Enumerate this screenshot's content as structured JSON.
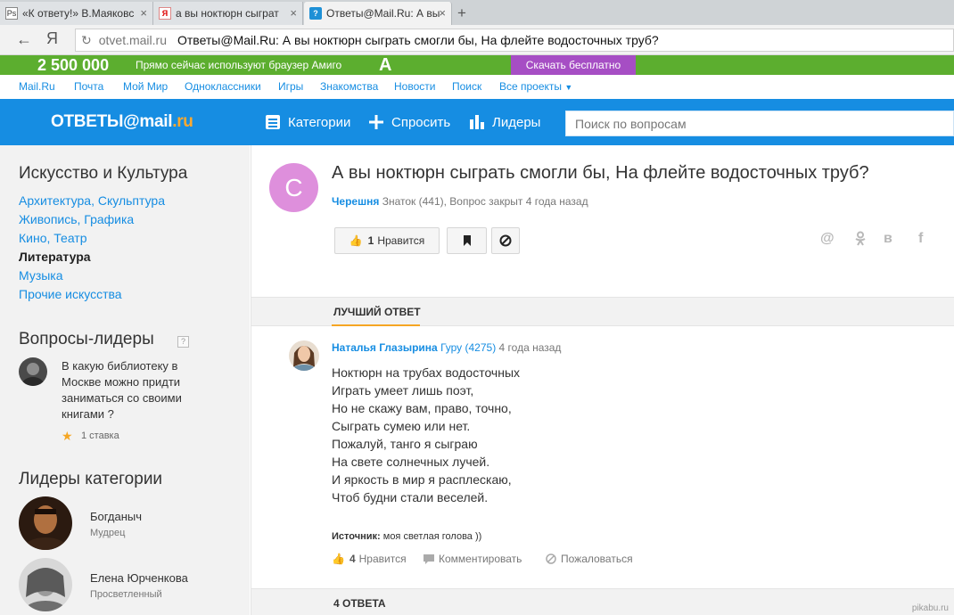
{
  "browser": {
    "tabs": [
      {
        "title": "«К ответу!» В.Маяковс",
        "favicon": "Ps",
        "active": false
      },
      {
        "title": "а вы ноктюрн сыграт",
        "favicon": "Я",
        "active": false
      },
      {
        "title": "Ответы@Mail.Ru: А вы",
        "favicon": "?",
        "active": true
      }
    ],
    "new_tab": "+",
    "back": "←",
    "home": "Я",
    "refresh": "↻",
    "url_host": "otvet.mail.ru",
    "url_title": "Ответы@Mail.Ru: А вы ноктюрн сыграть смогли бы, На флейте водосточных труб?"
  },
  "amigo": {
    "count": "2 500 000",
    "text": "Прямо сейчас используют браузер Амиго",
    "logo": "A",
    "download": "Скачать бесплатно",
    "bg_color": "#5cae2f",
    "button_color": "#a64ec4"
  },
  "portal_nav": [
    "Mail.Ru",
    "Почта",
    "Мой Мир",
    "Одноклассники",
    "Игры",
    "Знакомства",
    "Новости",
    "Поиск",
    "Все проекты"
  ],
  "header": {
    "brand_main": "ОТВЕТЫ@mail",
    "brand_ru": ".ru",
    "categories": "Категории",
    "ask": "Спросить",
    "leaders": "Лидеры",
    "search_placeholder": "Поиск по вопросам",
    "color": "#168de2"
  },
  "sidebar": {
    "category_title": "Искусство и Культура",
    "subcategories": [
      {
        "label": "Архитектура, Скульптура",
        "current": false
      },
      {
        "label": "Живопись, Графика",
        "current": false
      },
      {
        "label": "Кино, Театр",
        "current": false
      },
      {
        "label": "Литература",
        "current": true
      },
      {
        "label": "Музыка",
        "current": false
      },
      {
        "label": "Прочие искусства",
        "current": false
      }
    ],
    "leader_questions_title": "Вопросы-лидеры",
    "help_icon": "?",
    "leader_question": "В какую библиотеку в Москве можно придти заниматься со своими книгами ?",
    "leader_question_rate": "1 ставка",
    "leaders_title": "Лидеры категории",
    "leaders": [
      {
        "name": "Богданыч",
        "rank": "Мудрец"
      },
      {
        "name": "Елена Юрченкова",
        "rank": "Просветленный"
      }
    ]
  },
  "question": {
    "avatar_letter": "С",
    "title": "А вы ноктюрн сыграть смогли бы, На флейте водосточных труб?",
    "author": "Черешня",
    "meta": "Знаток (441), Вопрос закрыт 4 года назад",
    "likes": "1",
    "like_label": "Нравится",
    "share_icons": [
      "@",
      "ok",
      "в",
      "f"
    ]
  },
  "best_answer": {
    "section_label": "ЛУЧШИЙ ОТВЕТ",
    "author": "Наталья Глазырина",
    "rank": "Гуру (4275)",
    "time": "4 года назад",
    "lines": [
      "Ноктюрн на трубах водосточных",
      "Играть умеет лишь поэт,",
      "Но не скажу вам, право, точно,",
      "Сыграть сумею или нет.",
      "Пожалуй, танго я сыграю",
      "На свете солнечных лучей.",
      "И яркость в мир я расплескаю,",
      "Чтоб будни стали веселей."
    ],
    "source_label": "Источник:",
    "source_text": "моя светлая голова ))",
    "likes": "4",
    "like_label": "Нравится",
    "comment_label": "Комментировать",
    "report_label": "Пожаловаться"
  },
  "answers_section": "4 ОТВЕТА",
  "watermark": "pikabu.ru"
}
